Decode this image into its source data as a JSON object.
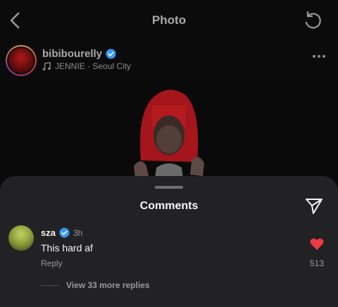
{
  "header": {
    "title": "Photo"
  },
  "post": {
    "username": "bibibourelly",
    "audio": "JENNIE · Seoul City"
  },
  "comments_sheet": {
    "title": "Comments",
    "comment": {
      "username": "sza",
      "time": "3h",
      "text": "This hard af",
      "reply_label": "Reply",
      "likes": "513",
      "view_replies": "View 33 more replies"
    }
  },
  "colors": {
    "like_heart": "#ed3a45",
    "verified_badge": "#3897f0"
  },
  "icons": [
    "back-arrow-icon",
    "refresh-icon",
    "verified-icon",
    "music-note-icon",
    "more-options-icon",
    "send-icon",
    "heart-icon"
  ]
}
